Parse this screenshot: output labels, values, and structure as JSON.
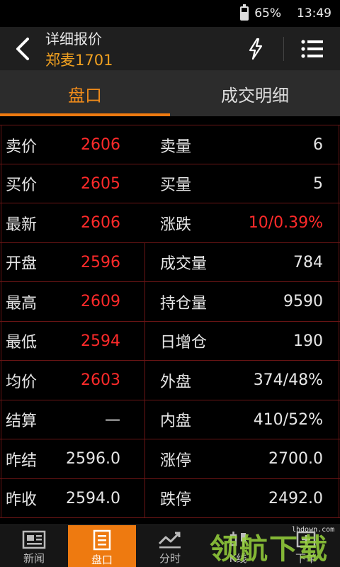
{
  "status_bar": {
    "battery": "65%",
    "time": "13:49"
  },
  "header": {
    "title": "详细报价",
    "subtitle": "郑麦1701"
  },
  "tabs": [
    {
      "label": "盘口",
      "active": true
    },
    {
      "label": "成交明细",
      "active": false
    }
  ],
  "quote_rows": [
    {
      "left_label": "卖价",
      "left_value": "2606",
      "right_label": "卖量",
      "right_value": "6"
    },
    {
      "left_label": "买价",
      "left_value": "2605",
      "right_label": "买量",
      "right_value": "5"
    },
    {
      "left_label": "最新",
      "left_value": "2606",
      "right_label": "涨跌",
      "right_value": "10/0.39%"
    },
    {
      "left_label": "开盘",
      "left_value": "2596",
      "right_label": "成交量",
      "right_value": "784"
    },
    {
      "left_label": "最高",
      "left_value": "2609",
      "right_label": "持仓量",
      "right_value": "9590"
    },
    {
      "left_label": "最低",
      "left_value": "2594",
      "right_label": "日增仓",
      "right_value": "190"
    },
    {
      "left_label": "均价",
      "left_value": "2603",
      "right_label": "外盘",
      "right_value": "374/48%"
    },
    {
      "left_label": "结算",
      "left_value": "—",
      "right_label": "内盘",
      "right_value": "410/52%"
    },
    {
      "left_label": "昨结",
      "left_value": "2596.0",
      "right_label": "涨停",
      "right_value": "2700.0"
    },
    {
      "left_label": "昨收",
      "left_value": "2594.0",
      "right_label": "跌停",
      "right_value": "2492.0"
    }
  ],
  "bottom_nav": [
    {
      "label": "新闻",
      "icon": "news-icon",
      "active": false
    },
    {
      "label": "盘口",
      "icon": "quote-icon",
      "active": true
    },
    {
      "label": "分时",
      "icon": "intraday-chart-icon",
      "active": false
    },
    {
      "label": "K线",
      "icon": "kline-icon",
      "active": false
    },
    {
      "label": "下单",
      "icon": "order-icon",
      "active": false
    }
  ],
  "watermark": {
    "text": "领航下载",
    "url": "lhdown.com"
  },
  "colors": {
    "accent": "#ee7a10",
    "price_red": "#ff2a2a",
    "subtitle_gold": "#f0a020",
    "grid_line": "#6a1515"
  }
}
